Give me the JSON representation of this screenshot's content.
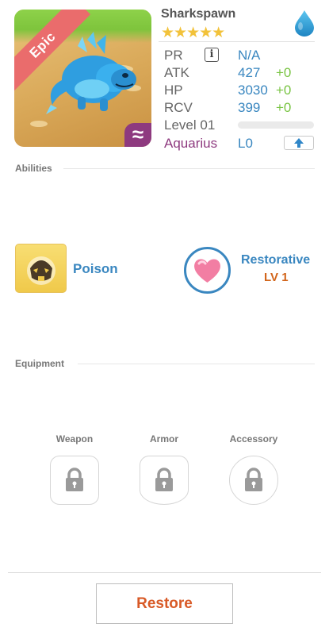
{
  "pet": {
    "name": "Sharkspawn",
    "rarity": "Epic",
    "stars": 5,
    "stars_display": "★★★★★",
    "element_icon": "water-drop-icon",
    "element_symbol": "≈"
  },
  "stats": {
    "pr_label": "PR",
    "pr_value": "N/A",
    "atk_label": "ATK",
    "atk_value": "427",
    "atk_bonus": "+0",
    "hp_label": "HP",
    "hp_value": "3030",
    "hp_bonus": "+0",
    "rcv_label": "RCV",
    "rcv_value": "399",
    "rcv_bonus": "+0",
    "level_label": "Level 01",
    "level_progress": 0,
    "constellation_label": "Aquarius",
    "constellation_level": "L0"
  },
  "abilities": {
    "header": "Abilities",
    "items": [
      {
        "name": "Poison",
        "icon": "poison-skull-icon"
      },
      {
        "name": "Restorative",
        "level": "LV 1",
        "icon": "heart-icon"
      }
    ]
  },
  "equipment": {
    "header": "Equipment",
    "slots": [
      {
        "label": "Weapon",
        "state": "locked"
      },
      {
        "label": "Armor",
        "state": "locked"
      },
      {
        "label": "Accessory",
        "state": "locked"
      }
    ]
  },
  "footer": {
    "restore_label": "Restore"
  },
  "colors": {
    "accent_blue": "#3a87c0",
    "bonus_green": "#79c443",
    "constellation_purple": "#8e3a7f",
    "restore_orange": "#d85a27",
    "epic_ribbon": "#ea6c6c",
    "star_gold": "#f2c23a"
  }
}
